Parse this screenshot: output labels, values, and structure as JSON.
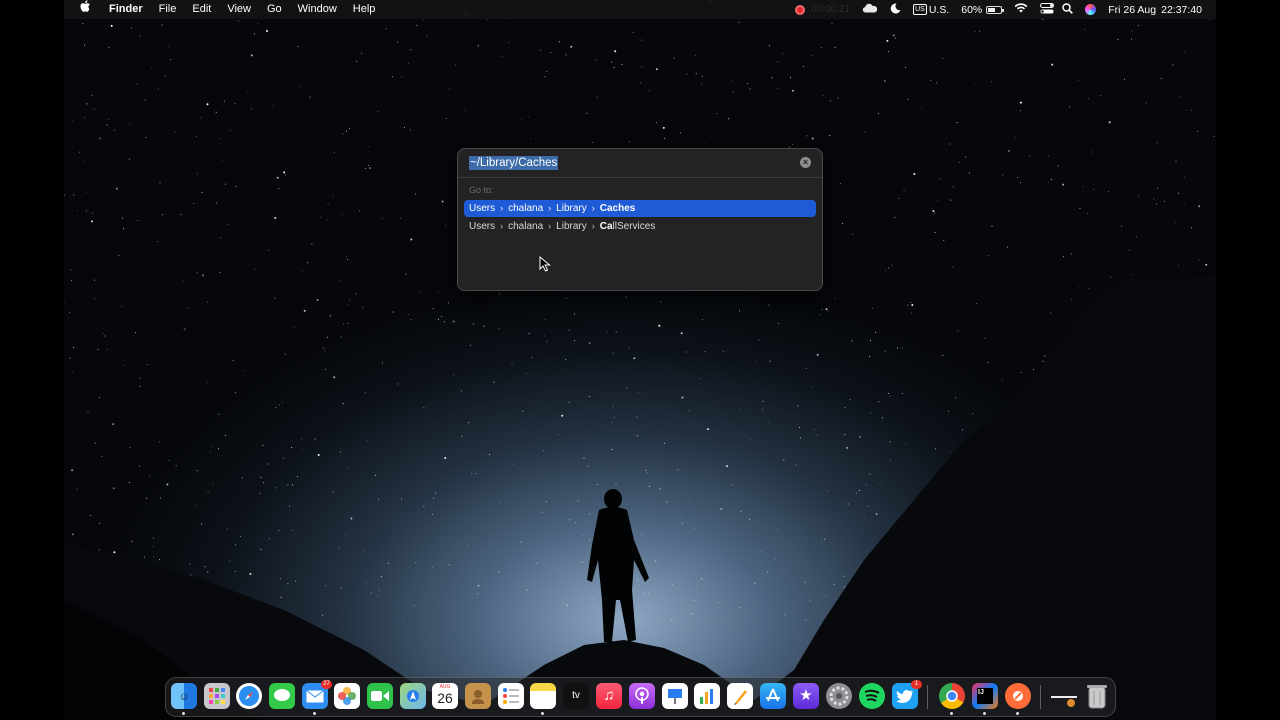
{
  "menubar": {
    "apple": "",
    "app": "Finder",
    "items": [
      "File",
      "Edit",
      "View",
      "Go",
      "Window",
      "Help"
    ],
    "recording_time": "00:00:21",
    "input_badge": "US",
    "input_source": "U.S.",
    "battery": "60%",
    "battery_level": 0.6,
    "date": "Fri 26 Aug",
    "time": "22:37:40"
  },
  "goto_dialog": {
    "path_value": "~/Library/Caches",
    "label": "Go to:",
    "suggestions": [
      {
        "crumbs": [
          "Users",
          "chalana",
          "Library"
        ],
        "match": "Ca",
        "rest": "ches",
        "selected": true
      },
      {
        "crumbs": [
          "Users",
          "chalana",
          "Library"
        ],
        "match": "Ca",
        "rest": "llServices",
        "selected": false
      }
    ],
    "separator": "›"
  },
  "dock": {
    "calendar_month": "AUG",
    "calendar_day": "26",
    "mail_badge": "27",
    "twitter_badge": "1",
    "apps": [
      "finder-icon",
      "launchpad-icon",
      "safari-icon",
      "messages-icon",
      "mail-icon",
      "photos-icon",
      "facetime-icon",
      "maps-icon",
      "calendar-icon",
      "contacts-icon",
      "reminders-icon",
      "notes-icon",
      "apple-tv-icon",
      "music-icon",
      "podcasts-icon",
      "keynote-icon",
      "numbers-icon",
      "pages-icon",
      "app-store-icon",
      "imovie-icon",
      "system-preferences-icon",
      "spotify-icon",
      "twitter-icon",
      "chrome-icon",
      "intellij-icon",
      "postman-icon",
      "downloads-stack-icon",
      "trash-icon"
    ],
    "tv_label": "tv"
  }
}
